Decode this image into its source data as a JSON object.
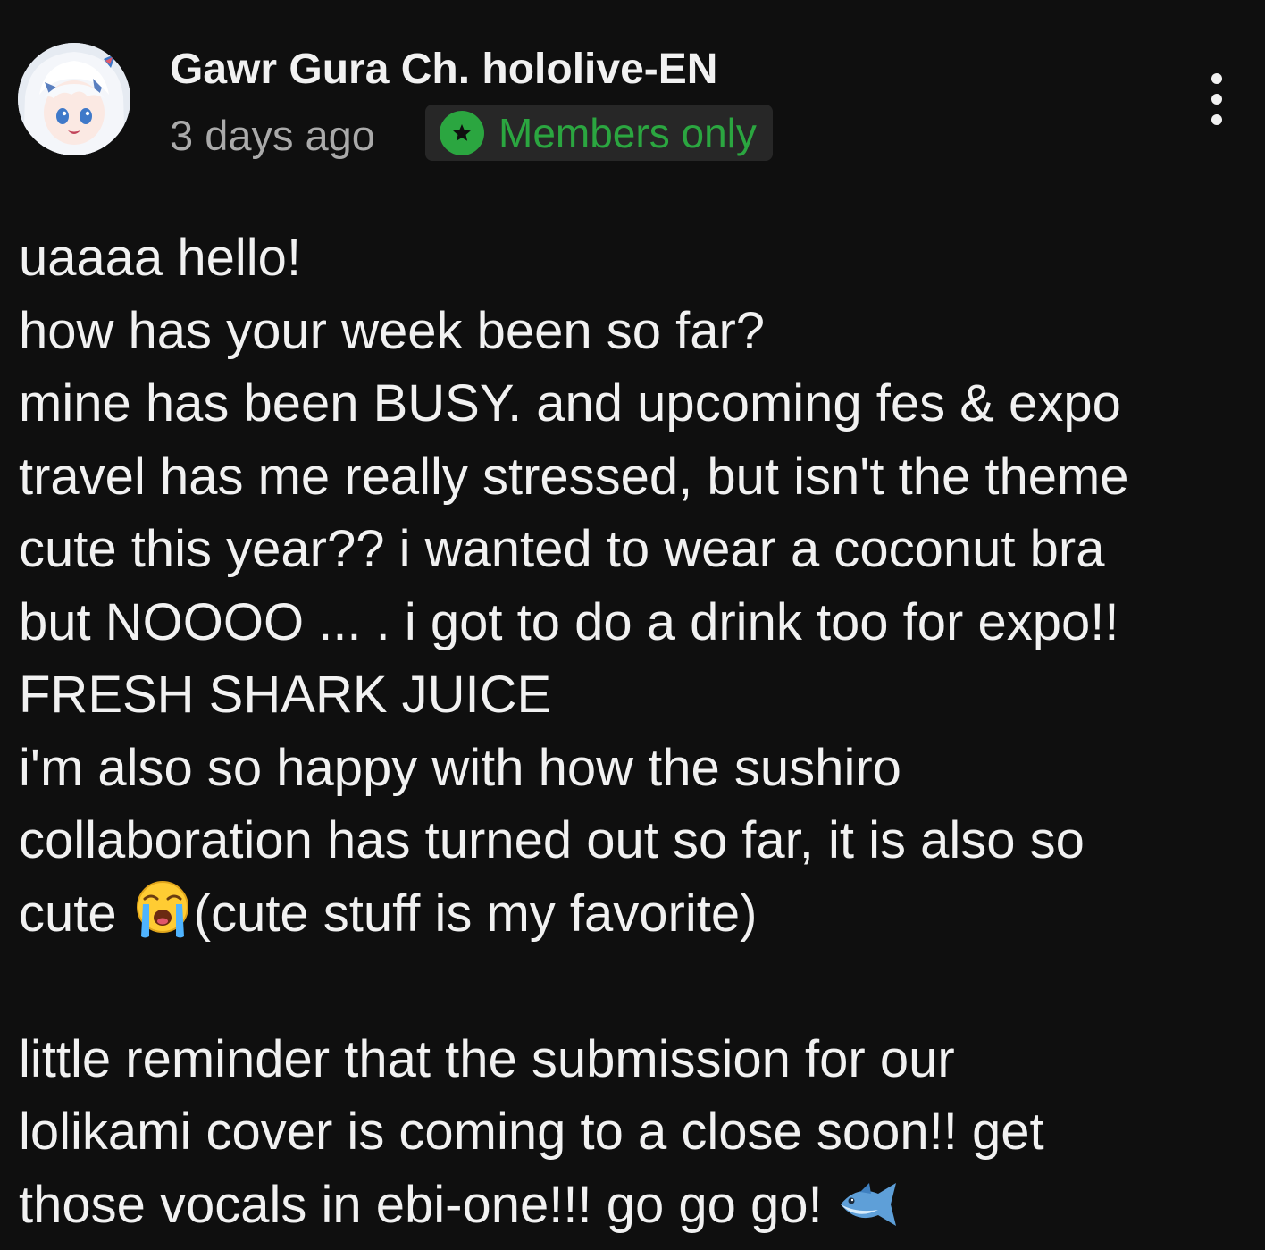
{
  "post": {
    "channel_name": "Gawr Gura Ch. hololive-EN",
    "timestamp": "3 days ago",
    "badge_label": "Members only",
    "avatar_icon": "channel-avatar",
    "badge_icon": "star-icon",
    "menu_icon": "more-vert-icon",
    "colors": {
      "background": "#0f0f0f",
      "text": "#f1f1f1",
      "secondary_text": "#aaaaaa",
      "badge_green": "#2ba640",
      "badge_bg": "#272727"
    },
    "body_lines": [
      "uaaaa hello!",
      "how has your week been so far?",
      "mine has been BUSY. and upcoming fes & expo",
      "travel has me really stressed, but isn't the theme",
      "cute this year?? i wanted to wear a coconut bra",
      "but NOOOO ... . i got to do a drink too for expo!!",
      "FRESH SHARK JUICE",
      "i'm also so happy with how the sushiro",
      "collaboration has turned out so far, it is also so",
      "",
      "",
      "little reminder that the submission for our",
      "lolikami cover is coming to a close soon!! get",
      ""
    ],
    "line_10_before": "cute ",
    "line_10_emoji": "loudly-crying-face-emoji",
    "line_10_after": "(cute stuff is my favorite)",
    "line_14_before": "those vocals in ebi-one!!! go go go! ",
    "line_14_emoji": "fish-emoji"
  }
}
